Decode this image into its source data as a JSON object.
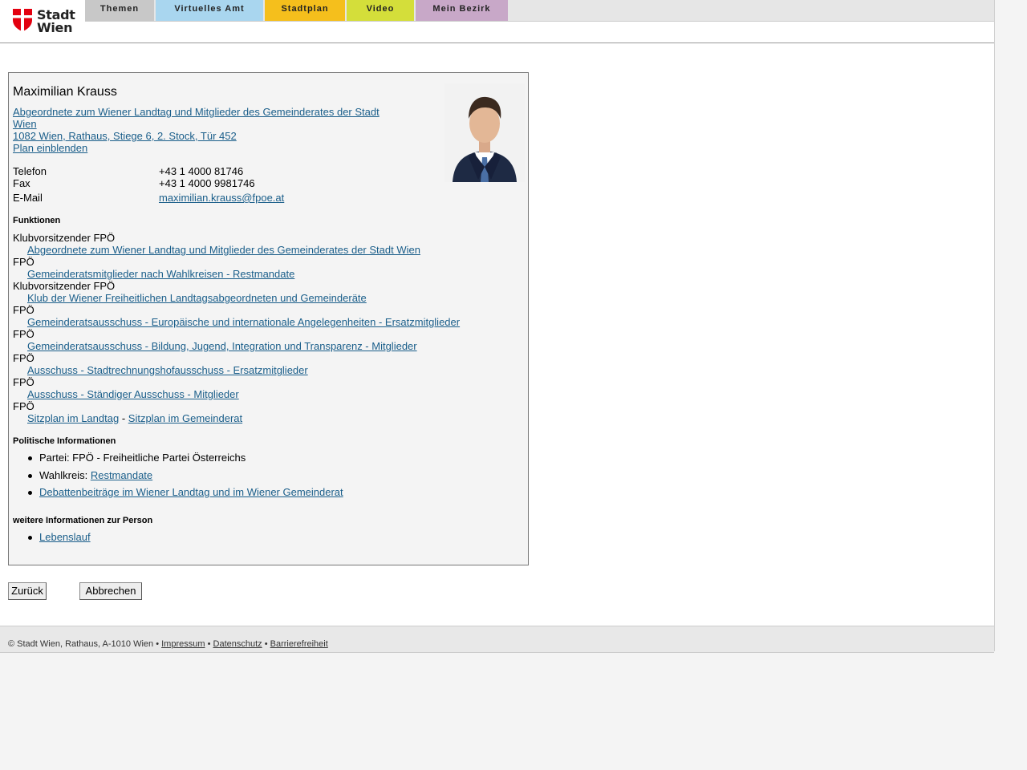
{
  "brand": {
    "line1": "Stadt",
    "line2": "Wien",
    "red": "#e3000f"
  },
  "nav": [
    {
      "label": "Themen",
      "color": "#c8c8c8"
    },
    {
      "label": "Virtuelles Amt",
      "color": "#a9d6ef"
    },
    {
      "label": "Stadtplan",
      "color": "#f5bf1c"
    },
    {
      "label": "Video",
      "color": "#d4de3a"
    },
    {
      "label": "Mein Bezirk",
      "color": "#c8a8c8"
    }
  ],
  "person": {
    "name": "Maximilian Krauss",
    "role_line1": "Abgeordnete zum Wiener Landtag und Mitglieder des Gemeinderates der Stadt",
    "role_line2": "Wien ",
    "address": "1082 Wien, Rathaus, Stiege 6, 2. Stock, Tür 452",
    "plan_link": "Plan einblenden"
  },
  "contact": [
    {
      "label": "Telefon",
      "value": "+43 1 4000 81746"
    },
    {
      "label": "Fax",
      "value": "+43 1 4000 9981746"
    },
    {
      "label": "E-Mail",
      "value": "maximilian.krauss@fpoe.at"
    }
  ],
  "functions": {
    "heading": "Funktionen",
    "items": [
      {
        "title": "Klubvorsitzender FPÖ",
        "link": "Abgeordnete zum Wiener Landtag und Mitglieder des Gemeinderates der Stadt Wien"
      },
      {
        "title": "FPÖ",
        "link": "Gemeinderatsmitglieder nach Wahlkreisen - Restmandate"
      },
      {
        "title": "Klubvorsitzender FPÖ",
        "link": "Klub der Wiener Freiheitlichen Landtagsabgeordneten und Gemeinderäte"
      },
      {
        "title": "FPÖ",
        "link": "Gemeinderatsausschuss - Europäische und internationale Angelegenheiten - Ersatzmitglieder"
      },
      {
        "title": "FPÖ",
        "link": "Gemeinderatsausschuss - Bildung, Jugend, Integration und Transparenz - Mitglieder"
      },
      {
        "title": "FPÖ",
        "link": "Ausschuss - Stadtrechnungshofausschuss - Ersatzmitglieder"
      },
      {
        "title": "FPÖ",
        "link": "Ausschuss - Ständiger Ausschuss - Mitglieder"
      }
    ],
    "last_title": "FPÖ",
    "seat_landtag": "Sitzplan im Landtag",
    "seat_sep": "-",
    "seat_gemeinderat": "Sitzplan im Gemeinderat"
  },
  "political": {
    "heading": "Politische Informationen",
    "party": "Partei: FPÖ - Freiheitliche Partei Österreichs",
    "district_label": "Wahlkreis:",
    "district_link": "Restmandate",
    "debates": "Debattenbeiträge im Wiener Landtag und im Wiener Gemeinderat"
  },
  "more": {
    "heading": "weitere Informationen zur Person",
    "cv": "Lebenslauf"
  },
  "buttons": {
    "back": "Zurück",
    "cancel": "Abbrechen"
  },
  "footer": {
    "copyright": "© Stadt Wien, Rathaus, A-1010 Wien",
    "sep": "•",
    "impressum": "Impressum",
    "datenschutz": "Datenschutz",
    "barrierefreiheit": "Barrierefreiheit"
  }
}
